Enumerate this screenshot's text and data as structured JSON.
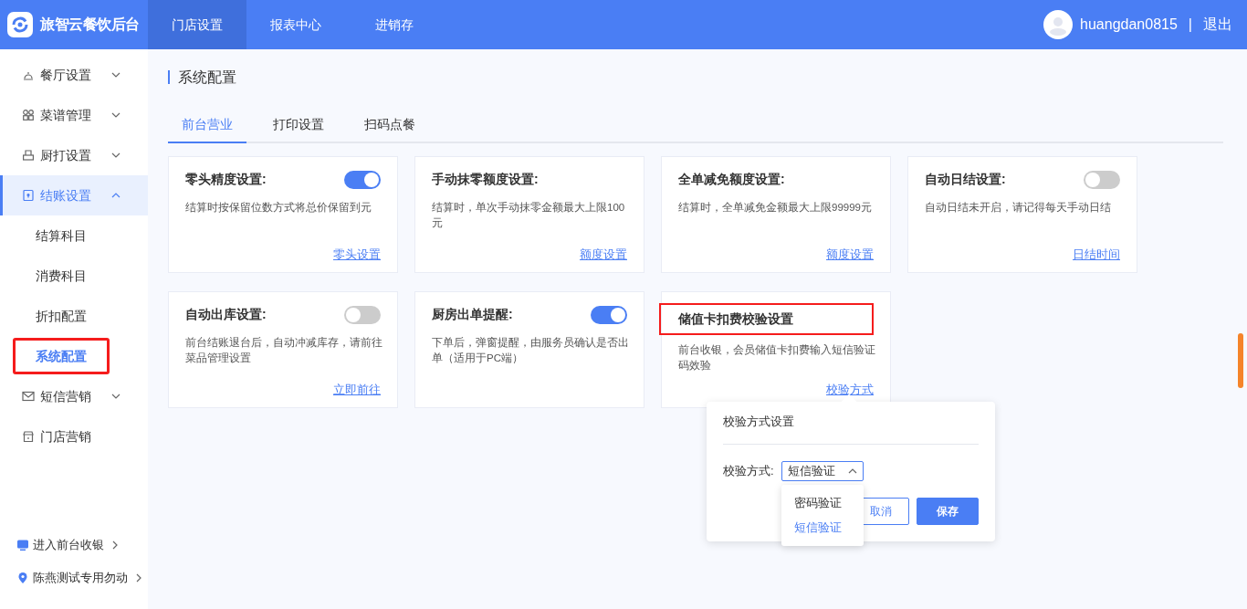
{
  "header": {
    "logo_text": "旅智云餐饮后台",
    "nav": [
      {
        "label": "门店设置",
        "selected": true
      },
      {
        "label": "报表中心",
        "selected": false
      },
      {
        "label": "进销存",
        "selected": false
      }
    ],
    "username": "huangdan0815",
    "separator": "|",
    "logout": "退出"
  },
  "sidebar": {
    "items": [
      {
        "label": "餐厅设置",
        "kind": "bell",
        "expanded": false,
        "selected": false
      },
      {
        "label": "菜谱管理",
        "kind": "grid",
        "expanded": false,
        "selected": false
      },
      {
        "label": "厨打设置",
        "kind": "printer",
        "expanded": false,
        "selected": false
      },
      {
        "label": "结账设置",
        "kind": "card",
        "expanded": true,
        "selected": true,
        "children": [
          {
            "label": "结算科目",
            "selected": false,
            "highlighted": false
          },
          {
            "label": "消费科目",
            "selected": false,
            "highlighted": false
          },
          {
            "label": "折扣配置",
            "selected": false,
            "highlighted": false
          },
          {
            "label": "系统配置",
            "selected": true,
            "highlighted": true
          }
        ]
      },
      {
        "label": "短信营销",
        "kind": "mail",
        "expanded": false,
        "selected": false
      },
      {
        "label": "门店营销",
        "kind": "store",
        "selected": false
      }
    ],
    "footer": [
      {
        "label": "进入前台收银",
        "kind": "monitor"
      },
      {
        "label": "陈燕测试专用勿动",
        "kind": "pin"
      }
    ]
  },
  "content": {
    "title": "系统配置",
    "tabs": [
      {
        "label": "前台营业",
        "selected": true
      },
      {
        "label": "打印设置",
        "selected": false
      },
      {
        "label": "扫码点餐",
        "selected": false
      }
    ],
    "cards": [
      {
        "title": "零头精度设置:",
        "on": true,
        "description": "结算时按保留位数方式将总价保留到元",
        "link": "零头设置",
        "highlighted": false
      },
      {
        "title": "手动抹零额度设置:",
        "description": "结算时，单次手动抹零金额最大上限100元",
        "link": "额度设置",
        "highlighted": false
      },
      {
        "title": "全单减免额度设置:",
        "description": "结算时，全单减免金额最大上限99999元",
        "link": "额度设置",
        "highlighted": false
      },
      {
        "title": "自动日结设置:",
        "on": false,
        "description": "自动日结未开启，请记得每天手动日结",
        "link": "日结时间",
        "highlighted": false
      },
      {
        "title": "自动出库设置:",
        "on": false,
        "description": "前台结账退台后，自动冲减库存，请前往菜品管理设置",
        "link": "立即前往",
        "highlighted": false
      },
      {
        "title": "厨房出单提醒:",
        "on": true,
        "description": "下单后，弹窗提醒，由服务员确认是否出单（适用于PC端）",
        "highlighted": false
      },
      {
        "title": "储值卡扣费校验设置",
        "description": "前台收银，会员储值卡扣费输入短信验证码效验",
        "link": "校验方式",
        "highlighted": true,
        "popover": {
          "title": "校验方式设置",
          "field_label": "校验方式:",
          "select": {
            "value": "短信验证",
            "expanded": true,
            "options": [
              {
                "label": "密码验证",
                "selected": false
              },
              {
                "label": "短信验证",
                "selected": true
              }
            ]
          },
          "buttons": [
            {
              "label": "取消",
              "kind": "secondary"
            },
            {
              "label": "保存",
              "kind": "primary"
            }
          ]
        }
      }
    ]
  }
}
